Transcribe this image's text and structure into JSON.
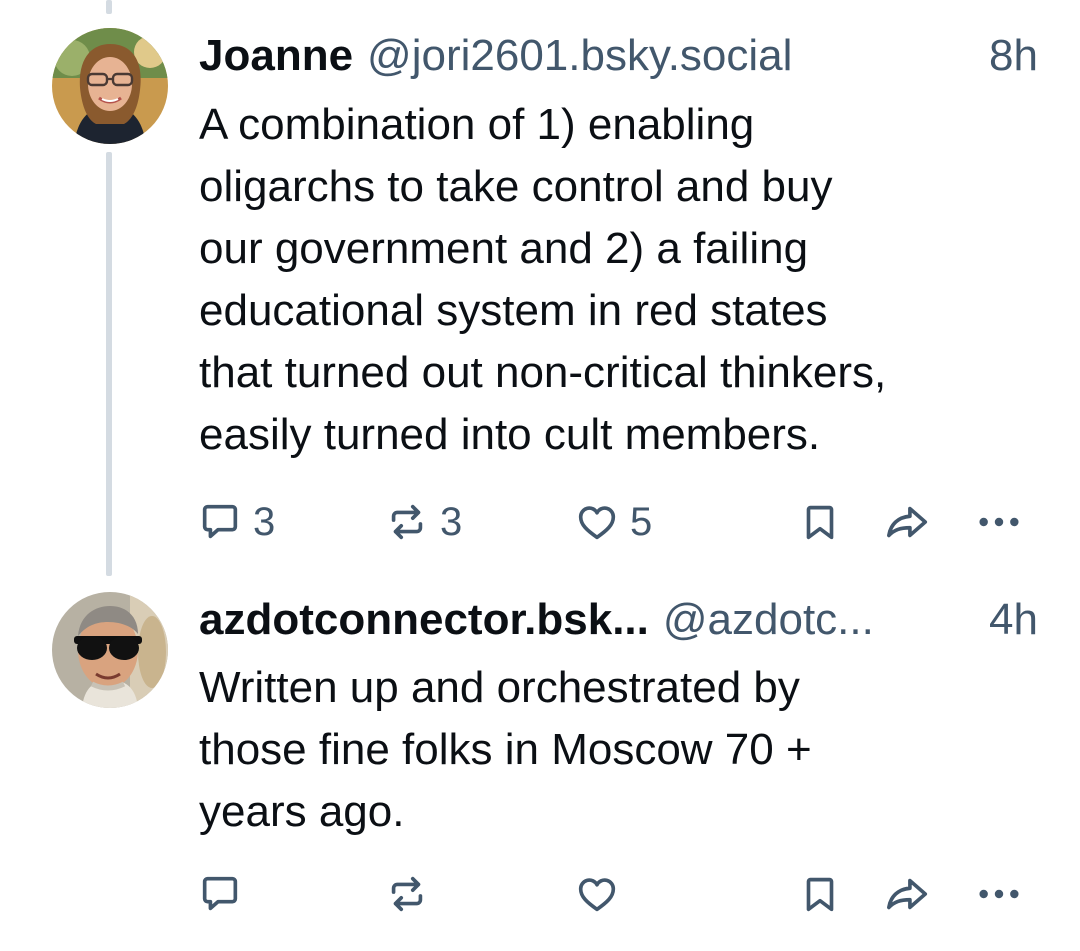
{
  "posts": [
    {
      "author": "Joanne",
      "handle": "@jori2601.bsky.social",
      "time": "8h",
      "text_lines": [
        "A combination of 1) enabling",
        "oligarchs to take control and buy",
        "our government and 2) a failing",
        "educational system in red states",
        "that turned out non-critical thinkers,",
        "easily turned into cult members."
      ],
      "counts": {
        "replies": "3",
        "reposts": "3",
        "likes": "5"
      },
      "avatar_icon": "woman-with-glasses-avatar"
    },
    {
      "author": "azdotconnector.bsk...",
      "handle": "@azdotc...",
      "time": "4h",
      "text_lines": [
        "Written up and orchestrated by",
        "those fine folks in Moscow 70 +",
        "years ago."
      ],
      "counts": {
        "replies": "",
        "reposts": "",
        "likes": ""
      },
      "avatar_icon": "man-with-sunglasses-avatar"
    }
  ],
  "icons": [
    "reply-icon",
    "repost-icon",
    "like-icon",
    "bookmark-icon",
    "share-icon",
    "more-icon"
  ],
  "colors": {
    "text": "#0b0f14",
    "muted": "#42576c",
    "thread_line": "#d4dbe2"
  }
}
